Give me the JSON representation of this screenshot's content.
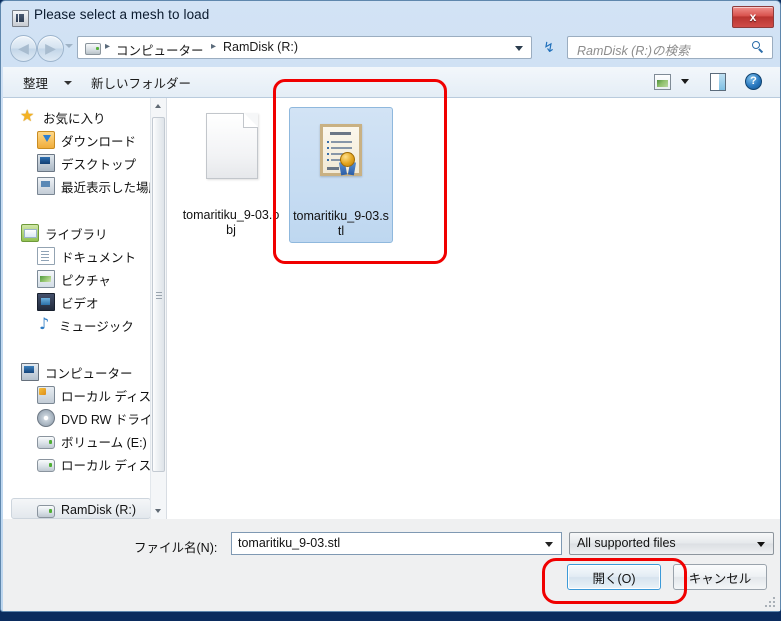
{
  "window": {
    "title": "Please select a mesh to load",
    "close_label": "x",
    "app_icon": "application-icon"
  },
  "navbar": {
    "back_glyph": "◀",
    "forward_glyph": "▶",
    "breadcrumb": {
      "separator": "▸",
      "items": [
        "コンピューター",
        "RamDisk (R:)"
      ]
    },
    "refresh_glyph": "↯",
    "search_placeholder": "RamDisk (R:)の検索"
  },
  "toolbar": {
    "organize_label": "整理",
    "new_folder_label": "新しいフォルダー",
    "view_mode_icon": "view-mode-icon",
    "preview_pane_icon": "preview-pane-icon",
    "help_label": "?"
  },
  "sidebar": {
    "groups": [
      {
        "label": "お気に入り",
        "icon": "star-icon",
        "items": [
          {
            "label": "ダウンロード",
            "icon": "downloads-folder-icon"
          },
          {
            "label": "デスクトップ",
            "icon": "desktop-icon"
          },
          {
            "label": "最近表示した場所",
            "icon": "recent-places-icon"
          }
        ]
      },
      {
        "label": "ライブラリ",
        "icon": "libraries-icon",
        "items": [
          {
            "label": "ドキュメント",
            "icon": "documents-icon"
          },
          {
            "label": "ピクチャ",
            "icon": "pictures-icon"
          },
          {
            "label": "ビデオ",
            "icon": "videos-icon"
          },
          {
            "label": "ミュージック",
            "icon": "music-icon"
          }
        ]
      },
      {
        "label": "コンピューター",
        "icon": "computer-icon",
        "items": [
          {
            "label": "ローカル ディス",
            "icon": "system-drive-icon"
          },
          {
            "label": "DVD RW ドライ",
            "icon": "dvd-drive-icon"
          },
          {
            "label": "ボリューム (E:)",
            "icon": "drive-icon"
          },
          {
            "label": "ローカル ディス",
            "icon": "drive-icon"
          },
          {
            "label": "RamDisk (R:)",
            "icon": "drive-icon",
            "selected": true
          }
        ]
      }
    ]
  },
  "files": [
    {
      "name": "tomaritiku_9-03.obj",
      "icon": "blank-document-icon",
      "selected": false
    },
    {
      "name": "tomaritiku_9-03.stl",
      "icon": "certificate-document-icon",
      "selected": true
    }
  ],
  "footer": {
    "filename_label": "ファイル名(N):",
    "filename_value": "tomaritiku_9-03.stl",
    "filter_value": "All supported files",
    "open_label": "開く(O)",
    "cancel_label": "キャンセル"
  },
  "annotations": {
    "accent_color": "#f00000",
    "targets": [
      "selected-file-item",
      "open-button"
    ]
  },
  "colors": {
    "window_frame": "#bcd6ef",
    "selection_blue": "#bed7f0",
    "close_red": "#d8534e",
    "focus_border": "#3c9ad8"
  }
}
